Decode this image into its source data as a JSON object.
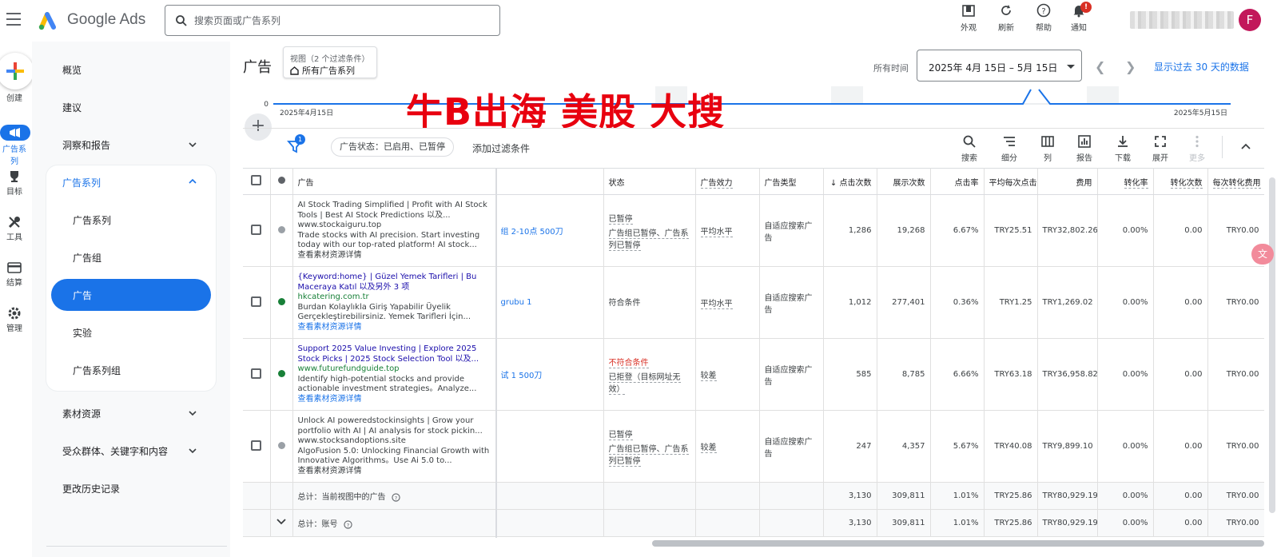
{
  "app": {
    "brand": "Google Ads"
  },
  "search": {
    "placeholder": "搜索页面或广告系列"
  },
  "toolbar": {
    "appearance": "外观",
    "refresh": "刷新",
    "help": "帮助",
    "notifications": "通知",
    "notif_count": "!",
    "avatar_letter": "F"
  },
  "rail": {
    "create": "创建",
    "campaigns": "广告系列",
    "goals": "目标",
    "tools": "工具",
    "billing": "结算",
    "admin": "管理"
  },
  "nav": {
    "overview": "概览",
    "recommendations": "建议",
    "insights": "洞察和报告",
    "campaigns_group": "广告系列",
    "sub_campaigns": "广告系列",
    "ad_groups": "广告组",
    "ads": "广告",
    "experiments": "实验",
    "campaign_groups": "广告系列组",
    "assets": "素材资源",
    "audiences": "受众群体、关键字和内容",
    "change_history": "更改历史记录"
  },
  "header": {
    "title": "广告",
    "view_line1": "视图（2 个过滤条件）",
    "view_line2": "所有广告系列",
    "date_label": "所有时间",
    "date_range": "2025年 4月 15日 – 5月 15日",
    "show_30": "显示过去 30 天的数据"
  },
  "chart": {
    "y_zero": "0",
    "start": "2025年4月15日",
    "end": "2025年5月15日"
  },
  "watermark": "牛B出海  美股 大搜",
  "filters": {
    "status_chip": "广告状态：已启用、已暂停",
    "add_filter": "添加过滤条件",
    "filter_count": "1"
  },
  "tools": {
    "search": "搜索",
    "segment": "细分",
    "columns": "列",
    "reports": "报告",
    "download": "下载",
    "expand": "展开",
    "more": "更多"
  },
  "table": {
    "headers": {
      "ad": "广告",
      "status": "状态",
      "ad_strength": "广告效力",
      "ad_type": "广告类型",
      "clicks": "点击次数",
      "impressions": "展示次数",
      "ctr": "点击率",
      "avg_cpc": "平均每次点击费用",
      "cost": "费用",
      "conv_rate": "转化率",
      "conversions": "转化次数",
      "cost_per_conv": "每次转化费用"
    },
    "rows": [
      {
        "status_dot": "#9aa0a6",
        "ad_line1": "AI Stock Trading Simplified | Profit with AI Stock Tools | Best AI Stock Predictions  以及...",
        "ad_url": "www.stockaiguru.top",
        "ad_desc": "Trade stocks with AI precision. Start investing today with our top-rated platform! AI stock...",
        "ad_link": "查看素材资源详情",
        "campaign": "组 2-10点 500刀",
        "status_main": "已暂停",
        "status_sub": "广告组已暂停、广告系列已暂停",
        "strength": "平均水平",
        "type": "自适应搜索广告",
        "clicks": "1,286",
        "impressions": "19,268",
        "ctr": "6.67%",
        "avg_cpc": "TRY25.51",
        "cost": "TRY32,802.26",
        "conv_rate": "0.00%",
        "conversions": "0.00",
        "cost_per_conv": "TRY0.00"
      },
      {
        "status_dot": "#188038",
        "ad_line1": "{Keyword:home} | Güzel Yemek Tarifleri | Bu Maceraya Katıl  以及另外 3 项",
        "ad_url": "hkcatering.com.tr",
        "ad_desc": "Burdan Kolaylıkla Giriş Yapabilir Üyelik Gerçekleştirebilirsiniz. Yemek Tarifleri İçin...",
        "ad_link": "查看素材资源详情",
        "campaign": "grubu 1",
        "status_main": "符合条件",
        "status_sub": "",
        "strength": "平均水平",
        "type": "自适应搜索广告",
        "clicks": "1,012",
        "impressions": "277,401",
        "ctr": "0.36%",
        "avg_cpc": "TRY1.25",
        "cost": "TRY1,269.02",
        "conv_rate": "0.00%",
        "conversions": "0.00",
        "cost_per_conv": "TRY0.00"
      },
      {
        "status_dot": "#188038",
        "ad_line1": "Support 2025 Value Investing | Explore 2025 Stock Picks | 2025 Stock Selection Tool  以及...",
        "ad_url": "www.futurefundguide.top",
        "ad_desc": "Identify high-potential stocks and provide actionable investment strategies。Analyze...",
        "ad_link": "查看素材资源详情",
        "campaign": "试 1   500刀",
        "status_main": "不符合条件",
        "status_sub": "已拒登（目标网址无效）",
        "strength": "较差",
        "type": "自适应搜索广告",
        "clicks": "585",
        "impressions": "8,785",
        "ctr": "6.66%",
        "avg_cpc": "TRY63.18",
        "cost": "TRY36,958.82",
        "conv_rate": "0.00%",
        "conversions": "0.00",
        "cost_per_conv": "TRY0.00"
      },
      {
        "status_dot": "#9aa0a6",
        "ad_line1": "Unlock AI poweredstockinsights | Grow your portfolio with AI | AI analysis for stock pickin...",
        "ad_url": "www.stocksandoptions.site",
        "ad_desc": "AlgoFusion 5.0: Unlocking Financial Growth with Innovative Algorithms。Use Ai 5.0 to...",
        "ad_link": "查看素材资源详情",
        "campaign": "",
        "status_main": "已暂停",
        "status_sub": "广告组已暂停、广告系列已暂停",
        "strength": "较差",
        "type": "自适应搜索广告",
        "clicks": "247",
        "impressions": "4,357",
        "ctr": "5.67%",
        "avg_cpc": "TRY40.08",
        "cost": "TRY9,899.10",
        "conv_rate": "0.00%",
        "conversions": "0.00",
        "cost_per_conv": "TRY0.00"
      }
    ],
    "totals": [
      {
        "label": "总计：当前视图中的广告",
        "clicks": "3,130",
        "impressions": "309,811",
        "ctr": "1.01%",
        "avg_cpc": "TRY25.86",
        "cost": "TRY80,929.19",
        "conv_rate": "0.00%",
        "conversions": "0.00",
        "cost_per_conv": "TRY0.00"
      },
      {
        "label": "总计：账号",
        "clicks": "3,130",
        "impressions": "309,811",
        "ctr": "1.01%",
        "avg_cpc": "TRY25.86",
        "cost": "TRY80,929.19",
        "conv_rate": "0.00%",
        "conversions": "0.00",
        "cost_per_conv": "TRY0.00"
      }
    ]
  },
  "colors": {
    "accent": "#1a73e8",
    "error": "#d93025",
    "enabled": "#188038"
  }
}
